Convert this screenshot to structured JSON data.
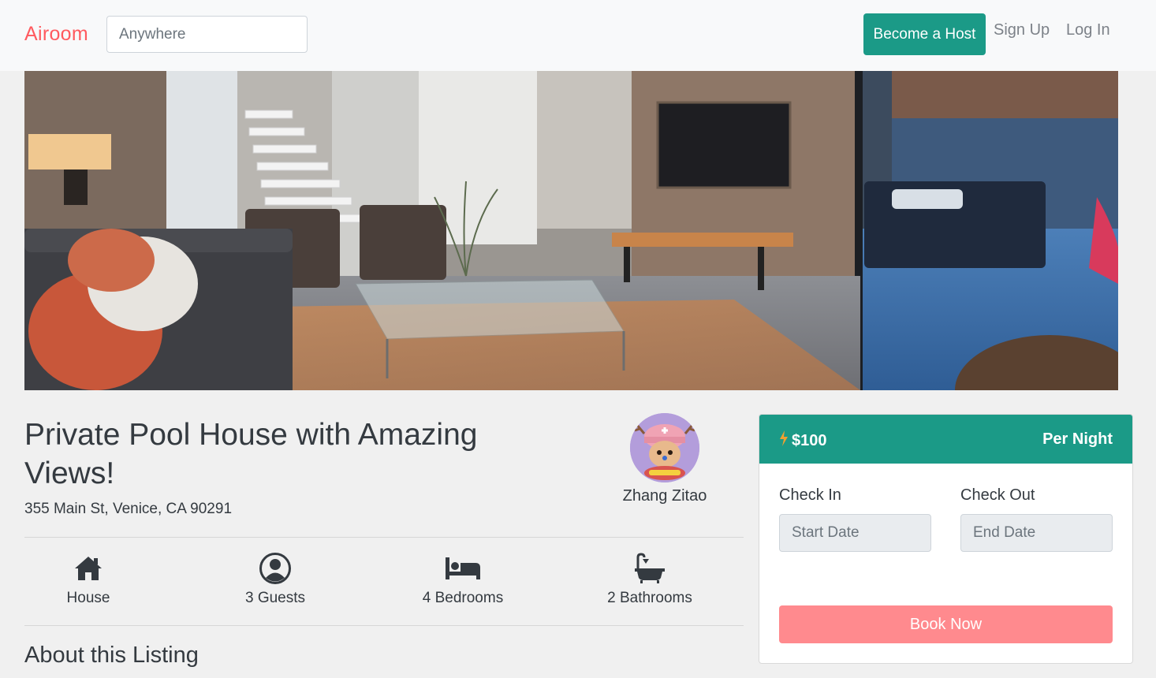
{
  "navbar": {
    "brand": "Airoom",
    "search_placeholder": "Anywhere",
    "host_button": "Become a Host",
    "signup": "Sign Up",
    "login": "Log In"
  },
  "listing": {
    "title": "Private Pool House with Amazing Views!",
    "address": "355 Main St, Venice, CA 90291",
    "host_name": "Zhang Zitao",
    "features": [
      {
        "icon": "home-icon",
        "label": "House"
      },
      {
        "icon": "user-icon",
        "label": "3 Guests"
      },
      {
        "icon": "bed-icon",
        "label": "4 Bedrooms"
      },
      {
        "icon": "bath-icon",
        "label": "2 Bathrooms"
      }
    ],
    "about_heading": "About this Listing"
  },
  "booking": {
    "price": "$100",
    "per": "Per Night",
    "check_in_label": "Check In",
    "check_out_label": "Check Out",
    "start_placeholder": "Start Date",
    "end_placeholder": "End Date",
    "book_button": "Book Now"
  },
  "colors": {
    "brand": "#ff5a5f",
    "teal": "#1b9a87",
    "book": "#ff8a8e",
    "bolt": "#f0a030"
  }
}
